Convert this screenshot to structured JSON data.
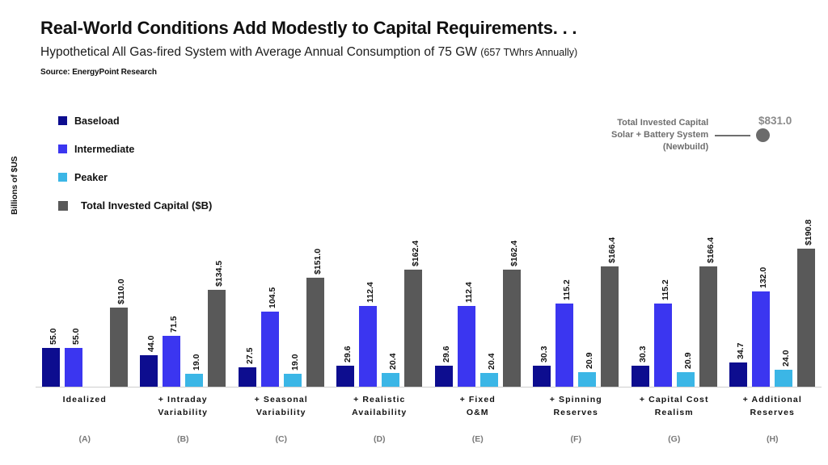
{
  "header": {
    "title": "Real-World Conditions Add Modestly to Capital Requirements. . .",
    "subtitle_main": "Hypothetical All Gas-fired System with Average Annual Consumption of 75 GW",
    "subtitle_paren": "(657 TWhrs Annually)",
    "source": "Source: EnergyPoint Research"
  },
  "legend": {
    "items": [
      {
        "label": "Baseload",
        "color": "#0d0d8f"
      },
      {
        "label": "Intermediate",
        "color": "#3b36f0"
      },
      {
        "label": "Peaker",
        "color": "#3bb6e6"
      },
      {
        "label": "Total Invested Capital ($B)",
        "color": "#595959"
      }
    ]
  },
  "annotation": {
    "line1": "Total Invested Capital",
    "line2": "Solar + Battery System",
    "line3": "(Newbuild)",
    "value": "$831.0",
    "color": "#6e6e6e"
  },
  "axis": {
    "y_title": "Billions of $US"
  },
  "chart_data": {
    "type": "bar",
    "title": "Real-World Conditions Add Modestly to Capital Requirements. . .",
    "subtitle": "Hypothetical All Gas-fired System with Average Annual Consumption of 75 GW (657 TWhrs Annually)",
    "xlabel": "",
    "ylabel": "Billions of $US",
    "ylim": [
      0,
      200
    ],
    "grid": false,
    "legend_position": "upper-left",
    "categories": [
      "Idealized",
      "+ Intraday Variability",
      "+ Seasonal Variability",
      "+ Realistic Availability",
      "+ Fixed O&M",
      "+ Spinning Reserves",
      "+ Capital Cost Realism",
      "+ Additional Reserves"
    ],
    "category_lines": [
      [
        "Idealized"
      ],
      [
        "+ Intraday",
        "Variability"
      ],
      [
        "+ Seasonal",
        "Variability"
      ],
      [
        "+ Realistic",
        "Availability"
      ],
      [
        "+ Fixed",
        "O&M"
      ],
      [
        "+ Spinning",
        "Reserves"
      ],
      [
        "+ Capital Cost",
        "Realism"
      ],
      [
        "+ Additional",
        "Reserves"
      ]
    ],
    "category_keys": [
      "(A)",
      "(B)",
      "(C)",
      "(D)",
      "(E)",
      "(F)",
      "(G)",
      "(H)"
    ],
    "series": [
      {
        "name": "Baseload",
        "color": "#0d0d8f",
        "values": [
          55.0,
          44.0,
          27.5,
          29.6,
          29.6,
          30.3,
          30.3,
          34.7
        ],
        "labels": [
          "55.0",
          "44.0",
          "27.5",
          "29.6",
          "29.6",
          "30.3",
          "30.3",
          "34.7"
        ]
      },
      {
        "name": "Intermediate",
        "color": "#3b36f0",
        "values": [
          55.0,
          71.5,
          104.5,
          112.4,
          112.4,
          115.2,
          115.2,
          132.0
        ],
        "labels": [
          "55.0",
          "71.5",
          "104.5",
          "112.4",
          "112.4",
          "115.2",
          "115.2",
          "132.0"
        ]
      },
      {
        "name": "Peaker",
        "color": "#3bb6e6",
        "values": [
          null,
          19.0,
          19.0,
          20.4,
          20.4,
          20.9,
          20.9,
          24.0
        ],
        "labels": [
          "",
          "19.0",
          "19.0",
          "20.4",
          "20.4",
          "20.9",
          "20.9",
          "24.0"
        ]
      },
      {
        "name": "Total Invested Capital ($B)",
        "color": "#595959",
        "values": [
          110.0,
          134.5,
          151.0,
          162.4,
          162.4,
          166.4,
          166.4,
          190.8
        ],
        "labels": [
          "$110.0",
          "$134.5",
          "$151.0",
          "$162.4",
          "$162.4",
          "$166.4",
          "$166.4",
          "$190.8"
        ]
      }
    ],
    "reference_marker": {
      "label": "Total Invested Capital Solar + Battery System (Newbuild)",
      "value": 831.0,
      "value_label": "$831.0"
    }
  }
}
